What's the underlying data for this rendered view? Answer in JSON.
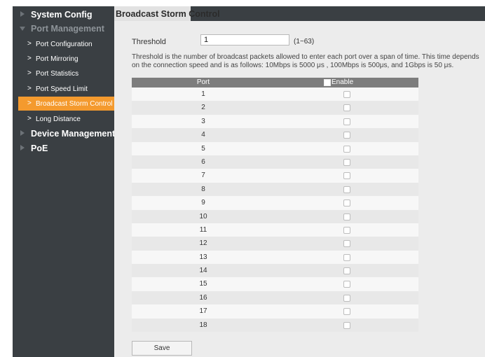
{
  "sidebar": {
    "sections": [
      {
        "label": "System Config"
      },
      {
        "label": "Port Management"
      },
      {
        "label": "Device Management"
      },
      {
        "label": "PoE"
      }
    ],
    "port_items": [
      {
        "label": "Port Configuration"
      },
      {
        "label": "Port Mirroring"
      },
      {
        "label": "Port Statistics"
      },
      {
        "label": "Port Speed Limit"
      },
      {
        "label": "Broadcast Storm Control"
      },
      {
        "label": "Long Distance"
      }
    ],
    "active_item": "Broadcast Storm Control"
  },
  "page": {
    "title": "Broadcast Storm Control",
    "threshold_label": "Threshold",
    "threshold_value": "1",
    "threshold_range": "(1~63)",
    "description": "Threshold is the number of broadcast packets allowed to enter each port over a span of time. This time depends on the connection speed and is as follows: 10Mbps is 5000 μs , 100Mbps is 500μs, and 1Gbps is 50 μs."
  },
  "table": {
    "col_port": "Port",
    "col_enable": "Enable",
    "rows": [
      "1",
      "2",
      "3",
      "4",
      "5",
      "6",
      "7",
      "8",
      "9",
      "10",
      "11",
      "12",
      "13",
      "14",
      "15",
      "16",
      "17",
      "18"
    ]
  },
  "save_label": "Save",
  "colors": {
    "sidebar_bg": "#3a3f43",
    "active": "#f49a2e",
    "table_header": "#7d7d7d"
  }
}
